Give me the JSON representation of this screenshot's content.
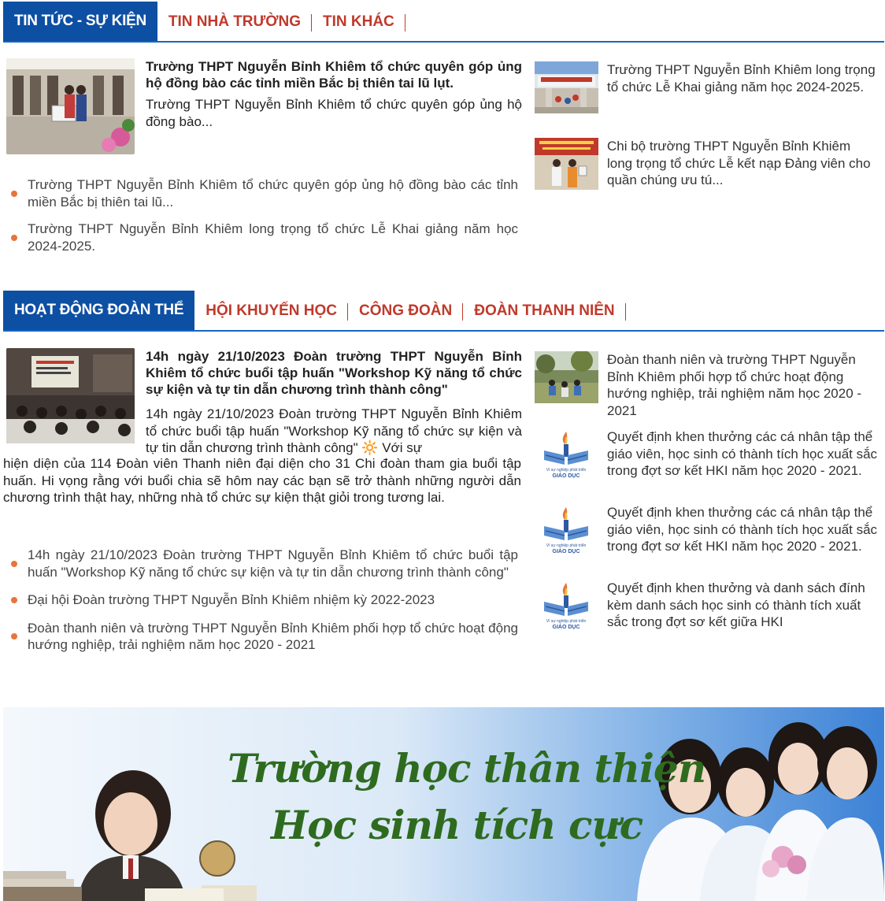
{
  "section1": {
    "tabs": [
      "TIN TỨC - SỰ KIỆN",
      "TIN NHÀ TRƯỜNG",
      "TIN KHÁC"
    ],
    "featured": {
      "title": "Trường THPT Nguyễn Bỉnh Khiêm tổ chức quyên góp ủng hộ đồng bào các tỉnh miền Bắc bị thiên tai lũ lụt.",
      "summary": "Trường THPT Nguyễn Bỉnh Khiêm tổ chức quyên góp ủng hộ đồng bào..."
    },
    "list": [
      "Trường THPT Nguyễn Bỉnh Khiêm tổ chức quyên góp ủng hộ đồng bào các tỉnh miền Bắc bị thiên tai lũ...",
      "Trường THPT Nguyễn Bỉnh Khiêm long trọng tổ chức Lễ Khai giảng năm học 2024-2025."
    ],
    "side": [
      "Trường THPT Nguyễn Bỉnh Khiêm long trọng tổ chức Lễ Khai giảng năm học 2024-2025.",
      "Chi bộ trường THPT Nguyễn Bỉnh Khiêm long trọng tổ chức Lễ kết nạp Đảng viên cho quần chúng ưu tú..."
    ]
  },
  "section2": {
    "tabs": [
      "HOẠT ĐỘNG ĐOÀN THỂ",
      "HỘI KHUYẾN HỌC",
      "CÔNG ĐOÀN",
      "ĐOÀN THANH NIÊN"
    ],
    "featured": {
      "title": "14h ngày 21/10/2023 Đoàn trường THPT Nguyễn Bỉnh Khiêm tổ chức buổi tập huấn \"Workshop Kỹ năng tổ chức sự kiện và tự tin dẫn chương trình thành công\"",
      "summary_part1": "14h ngày 21/10/2023 Đoàn trường THPT Nguyễn Bỉnh Khiêm tổ chức buổi tập huấn \"Workshop Kỹ năng tổ chức sự kiện và tự tin dẫn chương trình thành công\" 🔆 Với sự",
      "summary_part2": "hiện diện của 114 Đoàn viên Thanh niên đại diện cho 31 Chi đoàn tham gia buổi tập huấn. Hi vọng rằng với buổi chia sẽ hôm nay các bạn sẽ trở thành những người dẫn chương trình thật hay, những nhà tổ chức sự kiện thật giỏi trong tương lai."
    },
    "list": [
      "14h ngày 21/10/2023 Đoàn trường THPT Nguyễn Bỉnh Khiêm tổ chức buổi tập huấn \"Workshop Kỹ năng tổ chức sự kiện và tự tin dẫn chương trình thành công\"",
      "Đại hội Đoàn trường THPT Nguyễn Bỉnh Khiêm nhiệm kỳ 2022-2023",
      "Đoàn thanh niên và trường THPT Nguyễn Bỉnh Khiêm phối hợp tổ chức hoạt động hướng nghiệp, trải nghiệm năm học 2020 - 2021"
    ],
    "side": [
      "Đoàn thanh niên và trường THPT Nguyễn Bỉnh Khiêm phối hợp tổ chức hoạt động hướng nghiệp, trải nghiệm năm học 2020 - 2021",
      "Quyết định khen thưởng các cá nhân tập thể giáo viên, học sinh có thành tích học xuất sắc trong đợt sơ kết HKI năm học 2020 - 2021.",
      "Quyết định khen thưởng các cá nhân tập thể giáo viên, học sinh có thành tích học xuất sắc trong đợt sơ kết HKI năm học 2020 - 2021.",
      "Quyết định khen thưởng và danh sách đính kèm danh sách học sinh có thành tích xuất sắc trong đợt sơ kết giữa HKI"
    ],
    "logo_text": [
      "Vì sự nghiệp phát triển",
      "GIÁO DỤC"
    ]
  },
  "banner": {
    "line1": "Trường học thân thiện",
    "line2": "Học sinh tích cực"
  },
  "colors": {
    "tab_active": "#0d4fa3",
    "tab_text": "#c0392b",
    "bullet": "#e8743b",
    "banner_text": "#2e6b1f"
  }
}
